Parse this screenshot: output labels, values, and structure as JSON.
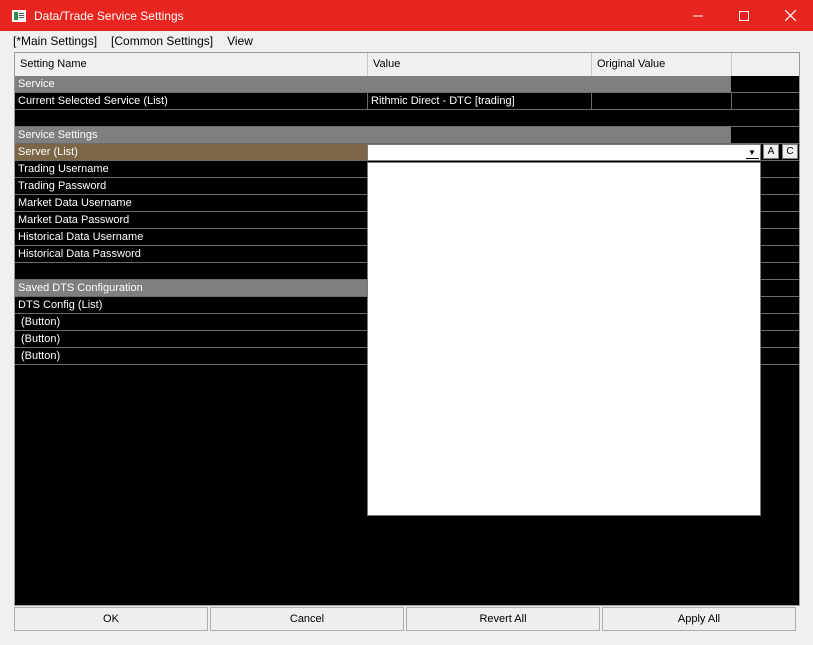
{
  "window": {
    "title": "Data/Trade Service Settings",
    "minimize_icon": "minimize-icon",
    "maximize_icon": "maximize-icon",
    "close_icon": "close-icon"
  },
  "menu": [
    "[*Main Settings]",
    "[Common Settings]",
    "View"
  ],
  "grid": {
    "headers": [
      "Setting Name",
      "Value",
      "Original Value"
    ],
    "service_section": "Service",
    "current_service": {
      "name": "Current Selected Service (List)",
      "value": "Rithmic Direct - DTC    [trading]"
    },
    "service_settings_section": "Service Settings",
    "rows": [
      "Server (List)",
      "Trading Username",
      "Trading Password",
      "Market Data Username",
      "Market Data Password",
      "Historical Data Username",
      "Historical Data Password"
    ],
    "saved_section": "Saved DTS Configuration",
    "saved_rows": [
      "DTS Config (List)",
      " (Button)",
      " (Button)",
      " (Button)"
    ],
    "server_combo_value": "",
    "btn_a": "A",
    "btn_c": "C"
  },
  "footer": {
    "ok": "OK",
    "cancel": "Cancel",
    "revert": "Revert All",
    "apply": "Apply All"
  },
  "colors": {
    "titlebar": "#e8251e",
    "grid_bg": "#000000",
    "section_bg": "#7f7f7f",
    "selected_bg": "#7d6646"
  }
}
